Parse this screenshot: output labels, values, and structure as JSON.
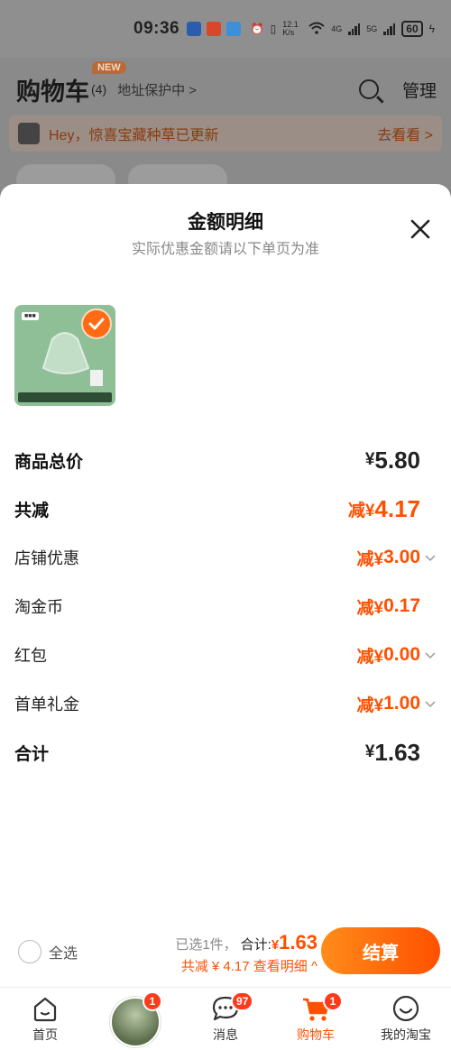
{
  "status_bar": {
    "time": "09:36",
    "network_speed": "12.1 K/s",
    "network_1": "4G",
    "network_2": "5G",
    "battery": "60"
  },
  "background": {
    "title": "购物车",
    "count": "(4)",
    "badge": "NEW",
    "address": "地址保护中 >",
    "manage": "管理",
    "notice": "Hey，惊喜宝藏种草已更新",
    "notice_link": "去看看 >"
  },
  "sheet": {
    "title": "金额明细",
    "subtitle": "实际优惠金额请以下单页为准",
    "rows": [
      {
        "label": "商品总价",
        "prefix": "¥",
        "amount": "5.80"
      },
      {
        "label": "共减",
        "prefix": "减¥",
        "amount": "4.17"
      },
      {
        "label": "店铺优惠",
        "prefix": "减¥",
        "amount": "3.00"
      },
      {
        "label": "淘金币",
        "prefix": "减¥",
        "amount": "0.17"
      },
      {
        "label": "红包",
        "prefix": "减¥",
        "amount": "0.00"
      },
      {
        "label": "首单礼金",
        "prefix": "减¥",
        "amount": "1.00"
      },
      {
        "label": "合计",
        "prefix": "¥",
        "amount": "1.63"
      }
    ]
  },
  "bottom_bar": {
    "select_all": "全选",
    "selected": "已选1件，",
    "total_label": "合计:",
    "total_currency": "¥",
    "total_amount": "1.63",
    "discount_summary": "共减 ¥ 4.17 查看明细 ^",
    "checkout": "结算"
  },
  "tabs": [
    {
      "label": "首页",
      "icon": "home-icon"
    },
    {
      "label": "",
      "icon": "avatar",
      "badge": "1"
    },
    {
      "label": "消息",
      "icon": "message-icon",
      "badge": "97"
    },
    {
      "label": "购物车",
      "icon": "cart-icon",
      "badge": "1"
    },
    {
      "label": "我的淘宝",
      "icon": "profile-icon"
    }
  ],
  "colors": {
    "accent": "#ff5000",
    "accent_gradient_start": "#ff8c1a",
    "overlay": "#8f8f8f"
  }
}
